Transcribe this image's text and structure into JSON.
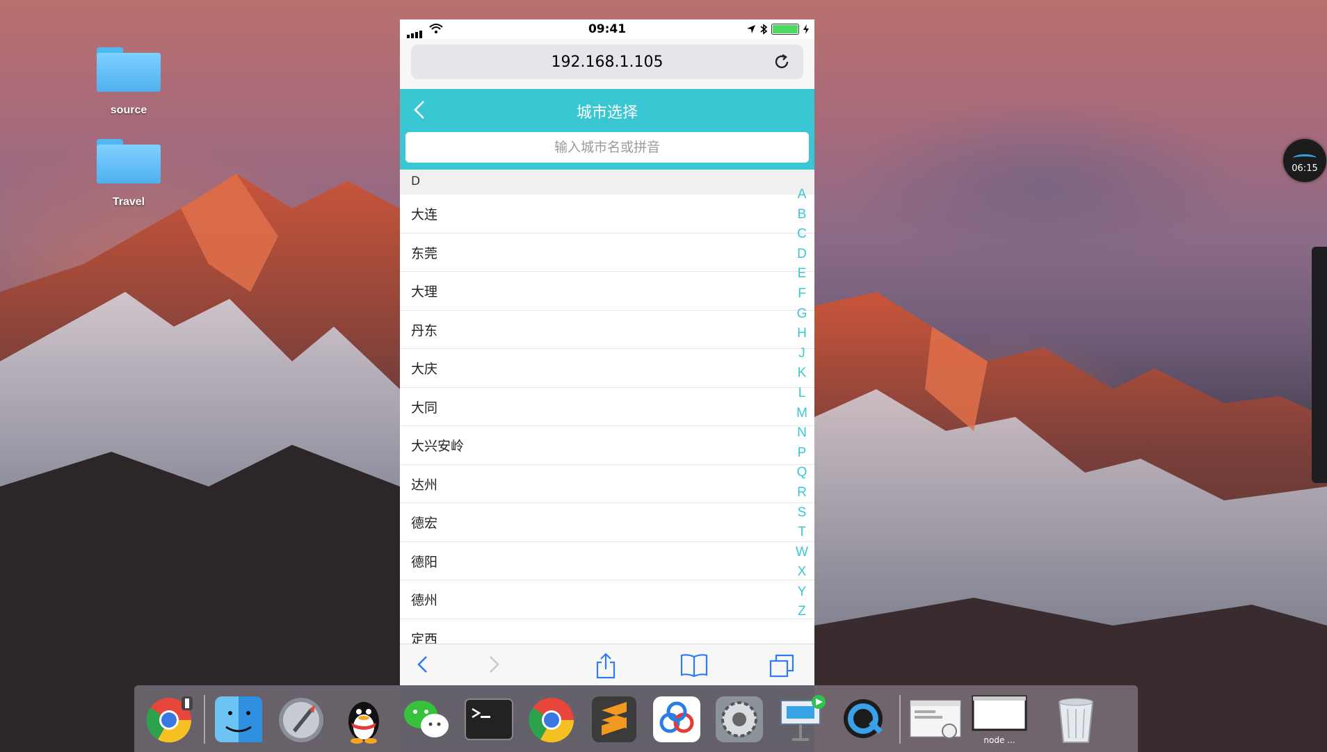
{
  "desktop": {
    "icons": [
      {
        "label": "source"
      },
      {
        "label": "Travel"
      }
    ],
    "timer": "06:15"
  },
  "phone": {
    "status": {
      "time": "09:41"
    },
    "browser": {
      "url": "192.168.1.105"
    },
    "header": {
      "title": "城市选择"
    },
    "search": {
      "placeholder": "输入城市名或拼音"
    },
    "section": {
      "letter": "D"
    },
    "cities": [
      "大连",
      "东莞",
      "大理",
      "丹东",
      "大庆",
      "大同",
      "大兴安岭",
      "达州",
      "德宏",
      "德阳",
      "德州",
      "定西"
    ],
    "alphabet": [
      "A",
      "B",
      "C",
      "D",
      "E",
      "F",
      "G",
      "H",
      "J",
      "K",
      "L",
      "M",
      "N",
      "P",
      "Q",
      "R",
      "S",
      "T",
      "W",
      "X",
      "Y",
      "Z"
    ]
  },
  "dock": {
    "apps": [
      "chrome-canary",
      "finder",
      "launchpad",
      "qq",
      "wechat",
      "terminal",
      "chrome",
      "sublime-text",
      "baidu-netdisk",
      "system-preferences",
      "keynote",
      "quicktime",
      "preview-window",
      "node-window",
      "trash"
    ],
    "node_label": "node ..."
  },
  "colors": {
    "accent": "#3ac7d4"
  }
}
